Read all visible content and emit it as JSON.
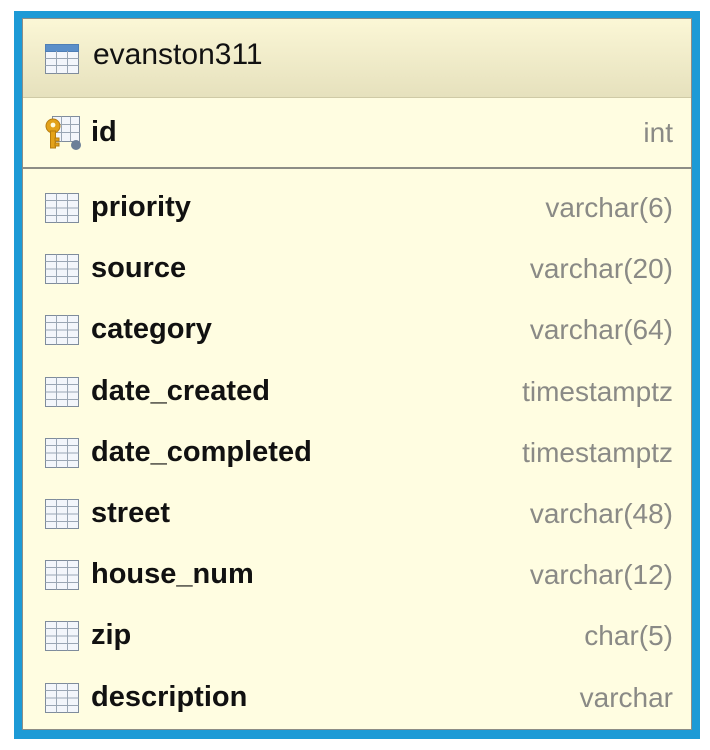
{
  "table": {
    "name": "evanston311",
    "primary_key": {
      "name": "id",
      "type": "int",
      "icon": "primary-key-column-icon"
    },
    "columns": [
      {
        "name": "priority",
        "type": "varchar(6)"
      },
      {
        "name": "source",
        "type": "varchar(20)"
      },
      {
        "name": "category",
        "type": "varchar(64)"
      },
      {
        "name": "date_created",
        "type": "timestamptz"
      },
      {
        "name": "date_completed",
        "type": "timestamptz"
      },
      {
        "name": "street",
        "type": "varchar(48)"
      },
      {
        "name": "house_num",
        "type": "varchar(12)"
      },
      {
        "name": "zip",
        "type": "char(5)"
      },
      {
        "name": "description",
        "type": "varchar"
      }
    ]
  },
  "colors": {
    "frame": "#1d9ad6",
    "card_background": "#fffde1",
    "type_text": "#8a8a86",
    "icon_blue": "#5b8fc9",
    "key_gold": "#e3a21a"
  }
}
